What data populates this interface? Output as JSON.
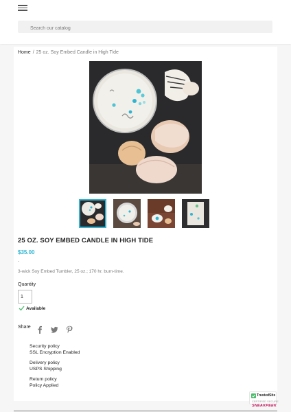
{
  "header": {
    "menu_icon": "hamburger-menu-icon",
    "search_placeholder": "Search our catalog"
  },
  "breadcrumb": {
    "home": "Home",
    "separator": "/",
    "current": "25 oz. Soy Embed Candle in High Tide"
  },
  "product": {
    "title": "25 OZ. SOY EMBED CANDLE IN HIGH TIDE",
    "price": "$35.00",
    "dash": "-",
    "description": "3-wick Soy Embed Tumbler, 25 oz.; 170 hr. burn-time.",
    "quantity_label": "Quantity",
    "quantity_value": "1",
    "availability": "Available",
    "accent_color": "#2fb5d2",
    "thumbnails": [
      {
        "selected": true
      },
      {
        "selected": false
      },
      {
        "selected": false
      },
      {
        "selected": false
      }
    ]
  },
  "share": {
    "label": "Share",
    "icons": [
      "facebook-icon",
      "twitter-icon",
      "pinterest-icon"
    ]
  },
  "reassurance": [
    {
      "title": "Security policy",
      "detail": "SSL Encryption Enabled"
    },
    {
      "title": "Delivery policy",
      "detail": "USPS Shipping"
    },
    {
      "title": "Return policy",
      "detail": "Policy Applied"
    }
  ],
  "badges": {
    "trusted_name": "TrustedSite",
    "trusted_sub": "CERTIFIED SECURE",
    "sneakpeek": "SNEAKPEEK"
  }
}
